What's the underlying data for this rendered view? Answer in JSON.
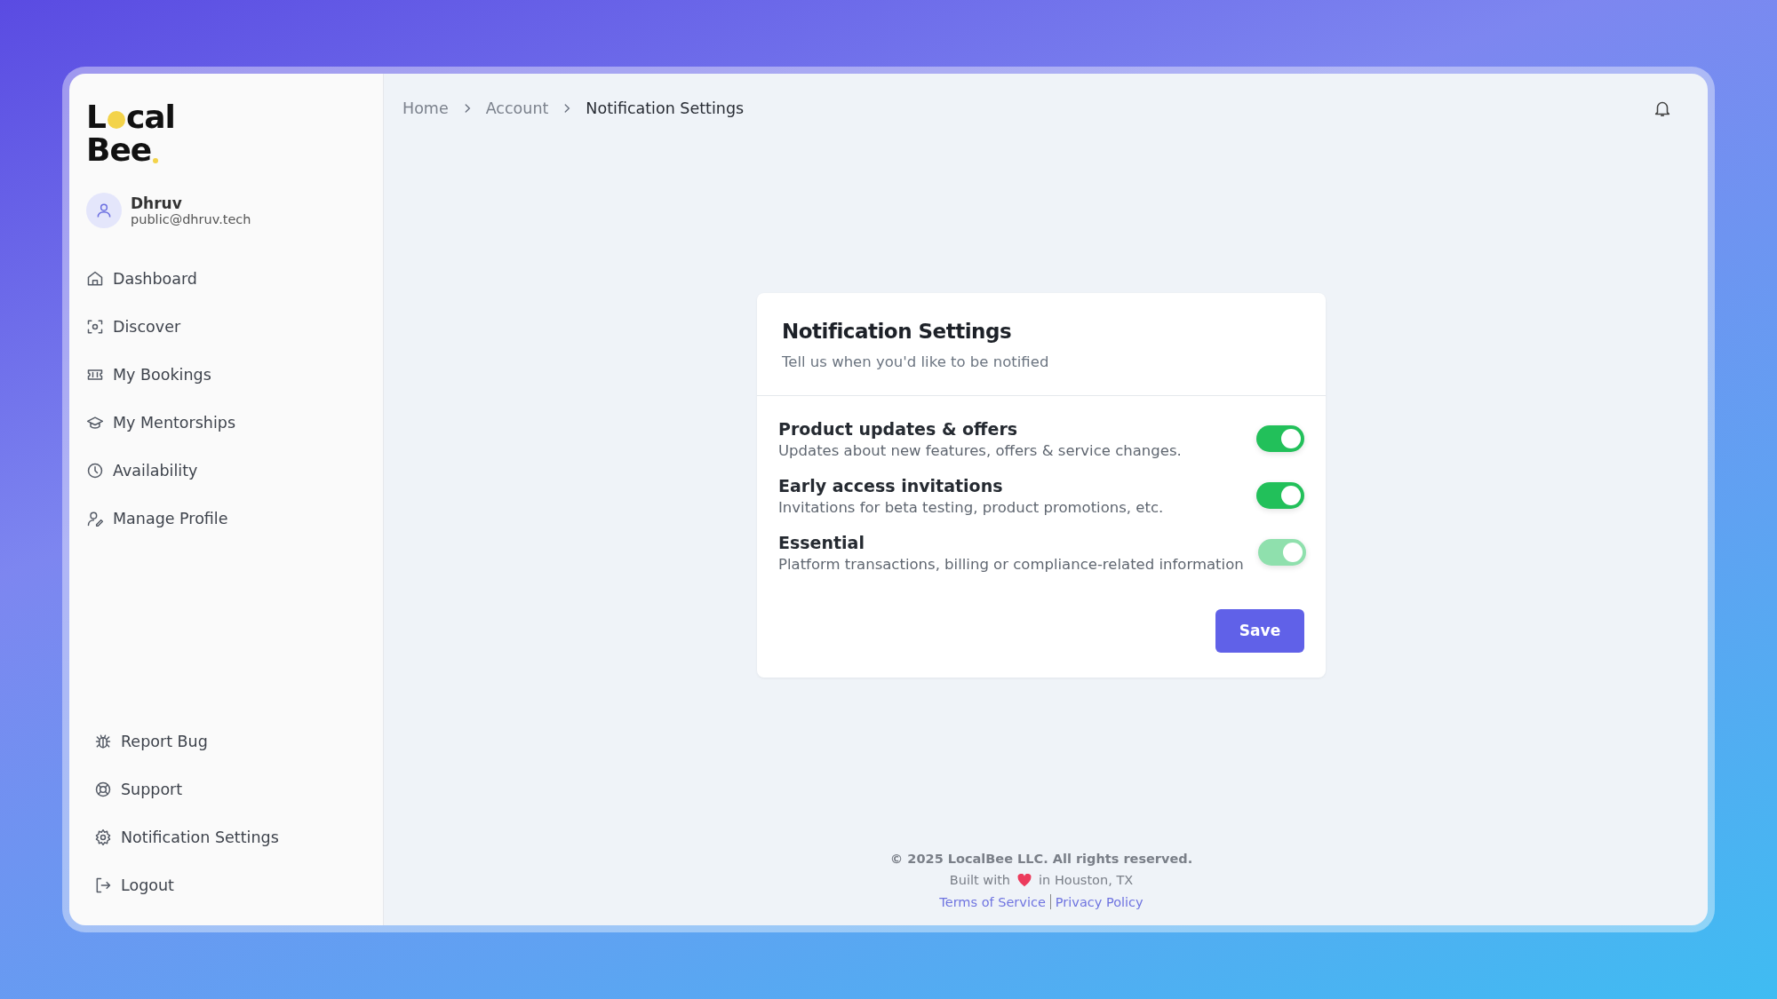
{
  "logo": {
    "line1_start": "L",
    "line1_end": "cal",
    "line2": "Bee"
  },
  "user": {
    "name": "Dhruv",
    "email": "public@dhruv.tech"
  },
  "sidebar": {
    "items": [
      {
        "label": "Dashboard"
      },
      {
        "label": "Discover"
      },
      {
        "label": "My Bookings"
      },
      {
        "label": "My Mentorships"
      },
      {
        "label": "Availability"
      },
      {
        "label": "Manage Profile"
      }
    ],
    "bottom_items": [
      {
        "label": "Report Bug"
      },
      {
        "label": "Support"
      },
      {
        "label": "Notification Settings"
      },
      {
        "label": "Logout"
      }
    ]
  },
  "breadcrumb": [
    {
      "label": "Home",
      "current": false
    },
    {
      "label": "Account",
      "current": false
    },
    {
      "label": "Notification Settings",
      "current": true
    }
  ],
  "card": {
    "title": "Notification Settings",
    "subtitle": "Tell us when you'd like to be notified",
    "options": [
      {
        "title": "Product updates & offers",
        "description": "Updates about new features, offers & service changes.",
        "on": true,
        "disabled": false
      },
      {
        "title": "Early access invitations",
        "description": "Invitations for beta testing, product promotions, etc.",
        "on": true,
        "disabled": false
      },
      {
        "title": "Essential",
        "description": "Platform transactions, billing or compliance-related information",
        "on": true,
        "disabled": true
      }
    ],
    "save_button": "Save"
  },
  "footer": {
    "copyright": "© 2025 LocalBee LLC. All rights reserved.",
    "built_before": "Built with",
    "built_after": "in Houston, TX",
    "links": [
      "Terms of Service",
      "Privacy Policy"
    ]
  }
}
